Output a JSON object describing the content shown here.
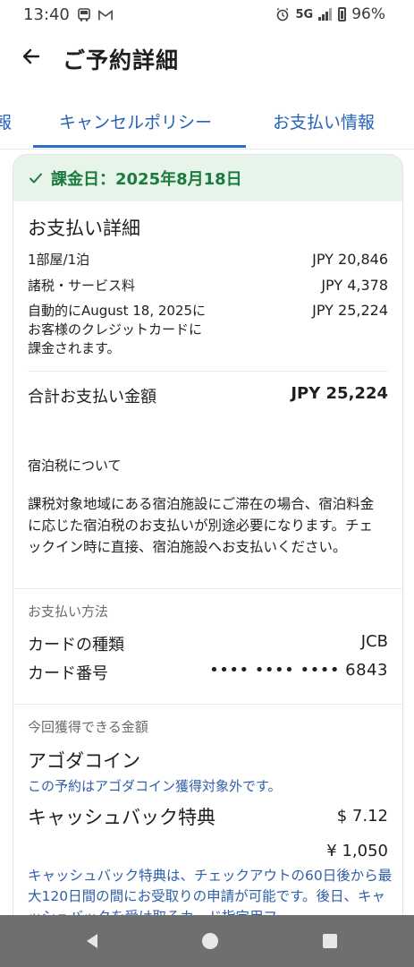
{
  "status_bar": {
    "time": "13:40",
    "network": "5G",
    "battery": "96%"
  },
  "header": {
    "title": "ご予約詳細"
  },
  "tabs": [
    {
      "label": "報"
    },
    {
      "label": "キャンセルポリシー"
    },
    {
      "label": "お支払い情報"
    }
  ],
  "charge_banner": {
    "text": "課金日：2025年8月18日",
    "color": "#1b7a3e"
  },
  "payment_details": {
    "title": "お支払い詳細",
    "rows": [
      {
        "label": "1部屋/1泊",
        "value": "JPY 20,846"
      },
      {
        "label": "諸税・サービス料",
        "value": "JPY 4,378"
      },
      {
        "label": "自動的にAugust 18, 2025にお客様のクレジットカードに課金されます。",
        "value": "JPY 25,224"
      }
    ],
    "total_label": "合計お支払い金額",
    "total_value": "JPY 25,224"
  },
  "accommodation_tax": {
    "title": "宿泊税について",
    "body": "課税対象地域にある宿泊施設にご滞在の場合、宿泊料金に応じた宿泊税のお支払いが別途必要になります。チェックイン時に直接、宿泊施設へお支払いください。"
  },
  "payment_method": {
    "section_label": "お支払い方法",
    "card_type_label": "カードの種類",
    "card_type_value": "JCB",
    "card_number_label": "カード番号",
    "card_number_value": "•••• •••• •••• 6843"
  },
  "earnings": {
    "section_label": "今回獲得できる金額",
    "coin_title": "アゴダコイン",
    "coin_note": "この予約はアゴダコイン獲得対象外です。",
    "cashback_title": "キャッシュバック特典",
    "cashback_usd": "$ 7.12",
    "cashback_jpy": "¥ 1,050",
    "cashback_note": "キャッシュバック特典は、チェックアウトの60日後から最大120日間の間にお受取りの申請が可能です。後日、キャッシュバックを受け取るカード指定用フ"
  },
  "nav_bar": {
    "back": "back-icon",
    "home": "home-icon",
    "recents": "recents-icon"
  }
}
